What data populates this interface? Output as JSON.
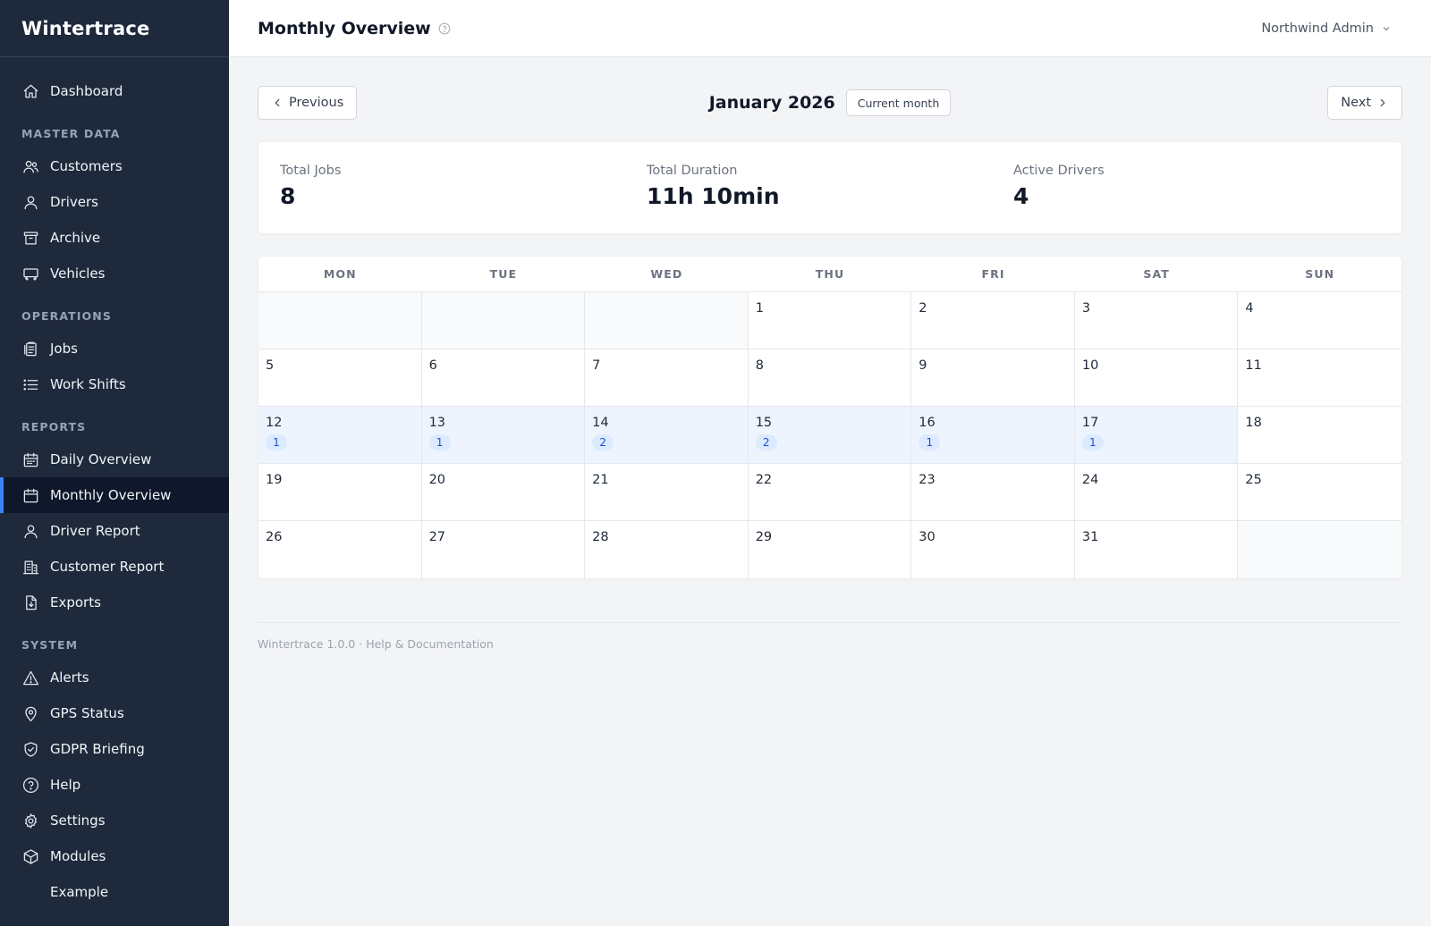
{
  "app": {
    "brand": "Wintertrace"
  },
  "sidebar": {
    "items_top": [
      {
        "label": "Dashboard",
        "icon": "home-icon"
      }
    ],
    "sections": [
      {
        "title": "MASTER DATA",
        "items": [
          {
            "label": "Customers",
            "icon": "users-icon"
          },
          {
            "label": "Drivers",
            "icon": "user-icon"
          },
          {
            "label": "Archive",
            "icon": "archive-icon"
          },
          {
            "label": "Vehicles",
            "icon": "vehicle-icon"
          }
        ]
      },
      {
        "title": "OPERATIONS",
        "items": [
          {
            "label": "Jobs",
            "icon": "clipboard-icon"
          },
          {
            "label": "Work Shifts",
            "icon": "list-icon"
          }
        ]
      },
      {
        "title": "REPORTS",
        "items": [
          {
            "label": "Daily Overview",
            "icon": "calendar-day-icon"
          },
          {
            "label": "Monthly Overview",
            "icon": "calendar-icon",
            "active": true
          },
          {
            "label": "Driver Report",
            "icon": "user-icon"
          },
          {
            "label": "Customer Report",
            "icon": "building-icon"
          },
          {
            "label": "Exports",
            "icon": "file-download-icon"
          }
        ]
      },
      {
        "title": "SYSTEM",
        "items": [
          {
            "label": "Alerts",
            "icon": "alert-triangle-icon"
          },
          {
            "label": "GPS Status",
            "icon": "map-pin-icon"
          },
          {
            "label": "GDPR Briefing",
            "icon": "shield-check-icon"
          },
          {
            "label": "Help",
            "icon": "help-circle-icon"
          },
          {
            "label": "Settings",
            "icon": "gear-icon"
          },
          {
            "label": "Modules",
            "icon": "cube-icon"
          },
          {
            "label": "Example",
            "icon": ""
          }
        ]
      }
    ]
  },
  "header": {
    "title": "Monthly Overview",
    "user": "Northwind Admin"
  },
  "month_nav": {
    "previous": "Previous",
    "next": "Next",
    "month": "January 2026",
    "current": "Current month"
  },
  "stats": [
    {
      "label": "Total Jobs",
      "value": "8"
    },
    {
      "label": "Total Duration",
      "value": "11h 10min"
    },
    {
      "label": "Active Drivers",
      "value": "4"
    }
  ],
  "calendar": {
    "weekdays": [
      "MON",
      "TUE",
      "WED",
      "THU",
      "FRI",
      "SAT",
      "SUN"
    ],
    "leading_blanks": 3,
    "days_in_month": 31,
    "job_counts": {
      "12": 1,
      "13": 1,
      "14": 2,
      "15": 2,
      "16": 1,
      "17": 1
    }
  },
  "footer": {
    "version": "Wintertrace 1.0.0",
    "separator": "·",
    "help_link": "Help & Documentation"
  }
}
